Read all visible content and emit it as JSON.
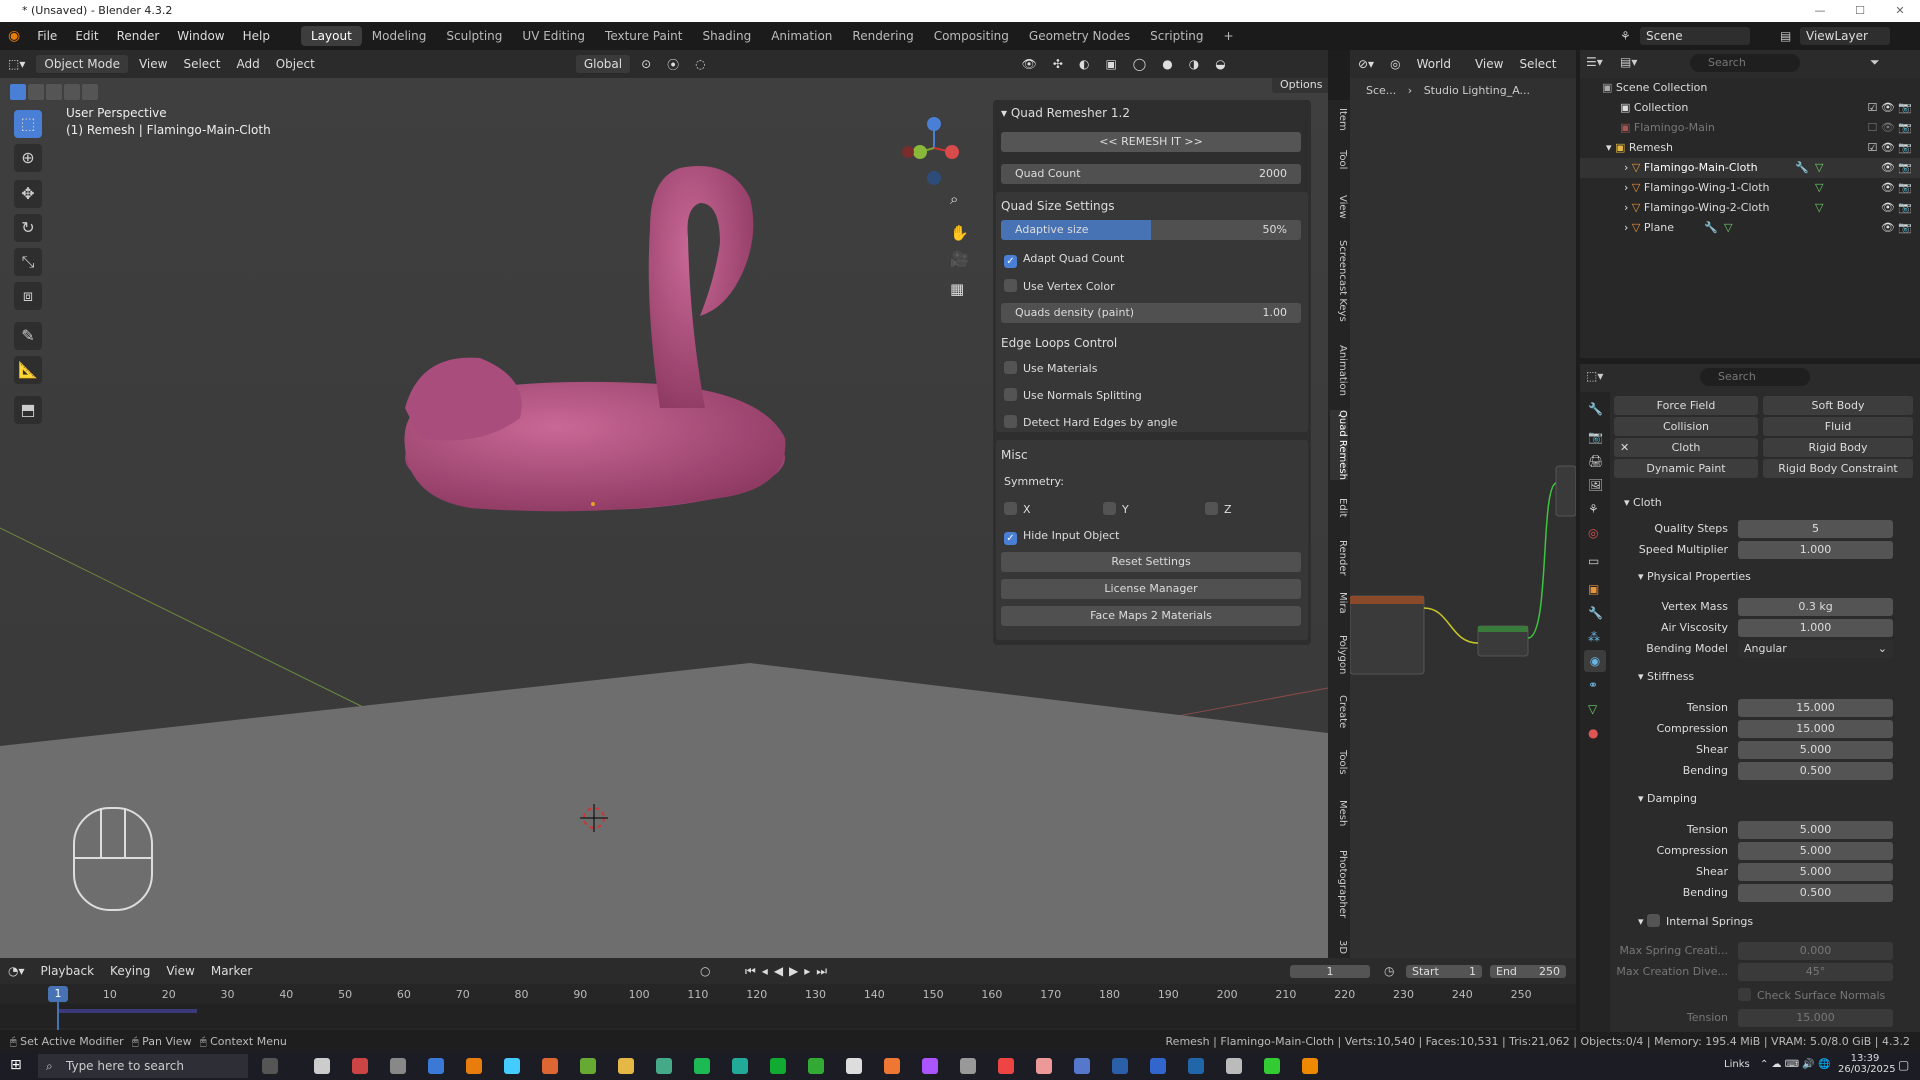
{
  "window": {
    "title": "* (Unsaved) - Blender 4.3.2"
  },
  "menus": [
    "File",
    "Edit",
    "Render",
    "Window",
    "Help"
  ],
  "workspaces": [
    "Layout",
    "Modeling",
    "Sculpting",
    "UV Editing",
    "Texture Paint",
    "Shading",
    "Animation",
    "Rendering",
    "Compositing",
    "Geometry Nodes",
    "Scripting"
  ],
  "active_workspace": "Layout",
  "scene": {
    "label": "Scene",
    "view_layer": "ViewLayer"
  },
  "viewport": {
    "mode": "Object Mode",
    "menus": [
      "View",
      "Select",
      "Add",
      "Object"
    ],
    "transform": "Global",
    "options": "Options",
    "perspective": "User Perspective",
    "object_info": "(1) Remesh | Flamingo-Main-Cloth"
  },
  "quad_remesher": {
    "title": "Quad Remesher 1.2",
    "remesh_button": "<< REMESH IT >>",
    "quad_count_label": "Quad Count",
    "quad_count": "2000",
    "size_settings": "Quad Size Settings",
    "adaptive_label": "Adaptive size",
    "adaptive_value": "50%",
    "adaptive_fraction": 0.5,
    "adapt_quad_count": "Adapt Quad Count",
    "use_vertex_color": "Use Vertex Color",
    "quads_density_label": "Quads density (paint)",
    "quads_density": "1.00",
    "edge_loops": "Edge Loops Control",
    "use_materials": "Use Materials",
    "use_normals": "Use Normals Splitting",
    "detect_hard": "Detect Hard Edges by angle",
    "misc": "Misc",
    "symmetry": "Symmetry:",
    "sx": "X",
    "sy": "Y",
    "sz": "Z",
    "hide_input": "Hide Input Object",
    "reset": "Reset Settings",
    "license": "License Manager",
    "facemaps": "Face Maps 2 Materials"
  },
  "side_tabs": [
    "Item",
    "Tool",
    "View",
    "Screencast Keys",
    "Animation",
    "Quad Remesh",
    "Edit",
    "Render",
    "Mira",
    "Polygon",
    "Create",
    "Tools",
    "Mesh",
    "Photographer",
    "3D"
  ],
  "node_editor": {
    "breadcrumb_1": "Sce...",
    "breadcrumb_2": "Studio Lighting_A...",
    "world": "World",
    "view": "View",
    "select": "Select"
  },
  "outliner": {
    "search_placeholder": "Search",
    "rows": [
      {
        "name": "Scene Collection"
      },
      {
        "name": "Collection"
      },
      {
        "name": "Flamingo-Main"
      },
      {
        "name": "Remesh"
      },
      {
        "name": "Flamingo-Main-Cloth"
      },
      {
        "name": "Flamingo-Wing-1-Cloth"
      },
      {
        "name": "Flamingo-Wing-2-Cloth"
      },
      {
        "name": "Plane"
      }
    ]
  },
  "physics": {
    "search_placeholder": "Search",
    "buttons": [
      "Force Field",
      "Soft Body",
      "Collision",
      "Fluid",
      "Cloth",
      "Rigid Body",
      "Dynamic Paint",
      "Rigid Body Constraint"
    ],
    "cloth": "Cloth",
    "quality_steps_label": "Quality Steps",
    "quality_steps": "5",
    "speed_label": "Speed Multiplier",
    "speed": "1.000",
    "physical": "Physical Properties",
    "mass_label": "Vertex Mass",
    "mass": "0.3 kg",
    "air_label": "Air Viscosity",
    "air": "1.000",
    "bending_model_label": "Bending Model",
    "bending_model": "Angular",
    "stiffness": "Stiffness",
    "st_tension_label": "Tension",
    "st_tension": "15.000",
    "st_compression_label": "Compression",
    "st_compression": "15.000",
    "st_shear_label": "Shear",
    "st_shear": "5.000",
    "st_bending_label": "Bending",
    "st_bending": "0.500",
    "damping": "Damping",
    "d_tension_label": "Tension",
    "d_tension": "5.000",
    "d_compression_label": "Compression",
    "d_compression": "5.000",
    "d_shear_label": "Shear",
    "d_shear": "5.000",
    "d_bending_label": "Bending",
    "d_bending": "0.500",
    "internal": "Internal Springs",
    "max_spring_label": "Max Spring Creati...",
    "max_spring": "0.000",
    "max_dive_label": "Max Creation Dive...",
    "max_dive": "45°",
    "check_normals": "Check Surface Normals",
    "i_tension_label": "Tension",
    "i_tension": "15.000"
  },
  "timeline": {
    "menus": [
      "Playback",
      "Keying",
      "View",
      "Marker"
    ],
    "current": "1",
    "start_label": "Start",
    "start": "1",
    "end_label": "End",
    "end": "250",
    "frames": [
      "10",
      "20",
      "30",
      "40",
      "50",
      "60",
      "70",
      "80",
      "90",
      "100",
      "110",
      "120",
      "130",
      "140",
      "150",
      "160",
      "170",
      "180",
      "190",
      "200",
      "210",
      "220",
      "230",
      "240",
      "250"
    ],
    "playhead": "1"
  },
  "status": {
    "left1": "Set Active Modifier",
    "left2": "Pan View",
    "left3": "Context Menu",
    "right": "Remesh | Flamingo-Main-Cloth | Verts:10,540 | Faces:10,531 | Tris:21,062 | Objects:0/4 | Memory: 195.4 MiB | VRAM: 5.0/8.0 GiB | 4.3.2"
  },
  "taskbar": {
    "search_placeholder": "Type here to search",
    "links": "Links",
    "time": "13:39",
    "date": "26/03/2025"
  }
}
